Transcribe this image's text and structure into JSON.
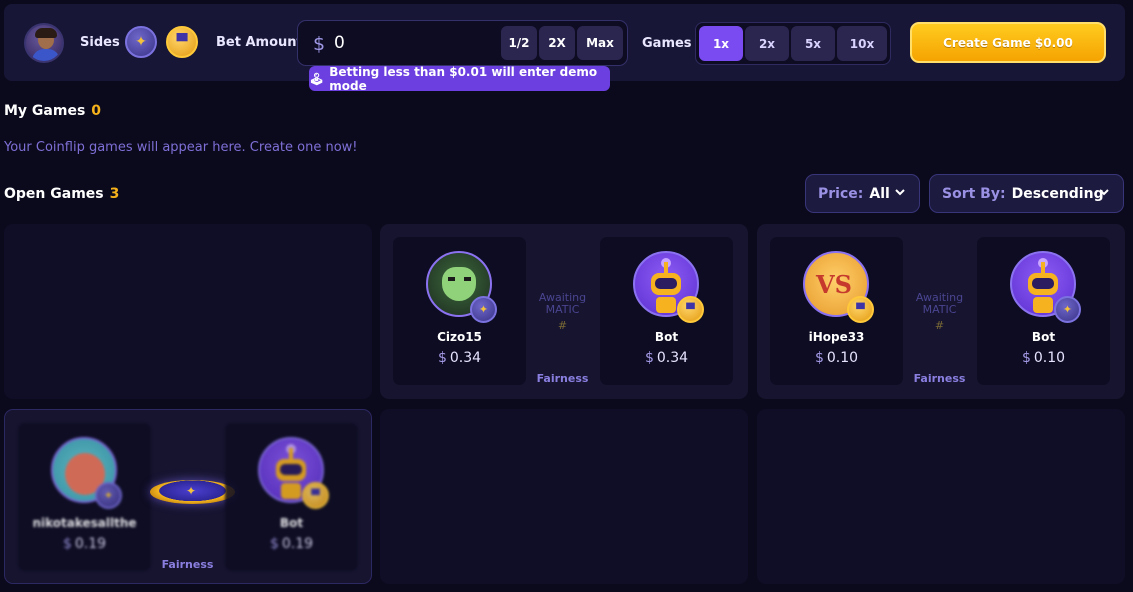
{
  "topbar": {
    "sides_label": "Sides",
    "bet_label": "Bet Amount",
    "bet_currency": "$",
    "bet_value": "0",
    "bet_buttons": [
      "1/2",
      "2X",
      "Max"
    ],
    "demo_tip": "Betting less than $0.01 will enter demo mode",
    "games_label": "Games",
    "games_options": [
      "1x",
      "2x",
      "5x",
      "10x"
    ],
    "games_selected": "1x",
    "create_label": "Create Game $0.00"
  },
  "my_games": {
    "title": "My Games",
    "count": "0",
    "empty_message": "Your Coinflip games will appear here. Create one now!"
  },
  "open_games": {
    "title": "Open Games",
    "count": "3",
    "price_filter": {
      "label": "Price:",
      "value": "All"
    },
    "sort_filter": {
      "label": "Sort By:",
      "value": "Descending"
    }
  },
  "games": [
    {
      "player1": {
        "name": "Cizo15",
        "currency": "$",
        "value": "0.34"
      },
      "player2": {
        "name": "Bot",
        "currency": "$",
        "value": "0.34"
      },
      "status_line1": "Awaiting",
      "status_line2": "MATIC",
      "hash": "#",
      "fairness": "Fairness"
    },
    {
      "player1": {
        "name": "iHope33",
        "currency": "$",
        "value": "0.10"
      },
      "player2": {
        "name": "Bot",
        "currency": "$",
        "value": "0.10"
      },
      "status_line1": "Awaiting",
      "status_line2": "MATIC",
      "hash": "#",
      "fairness": "Fairness"
    },
    {
      "player1": {
        "name": "nikotakesallthe",
        "currency": "$",
        "value": "0.19"
      },
      "player2": {
        "name": "Bot",
        "currency": "$",
        "value": "0.19"
      },
      "fairness": "Fairness"
    }
  ],
  "colors": {
    "background": "#0b0a1c",
    "panel": "#181637",
    "accent_purple": "#7a4bf0",
    "accent_gold": "#f6b21b"
  },
  "icons": {
    "side_a": "bird-coin-icon",
    "side_b": "hat-coin-icon",
    "demo": "joystick-icon",
    "dropdown": "chevron-down-icon"
  }
}
